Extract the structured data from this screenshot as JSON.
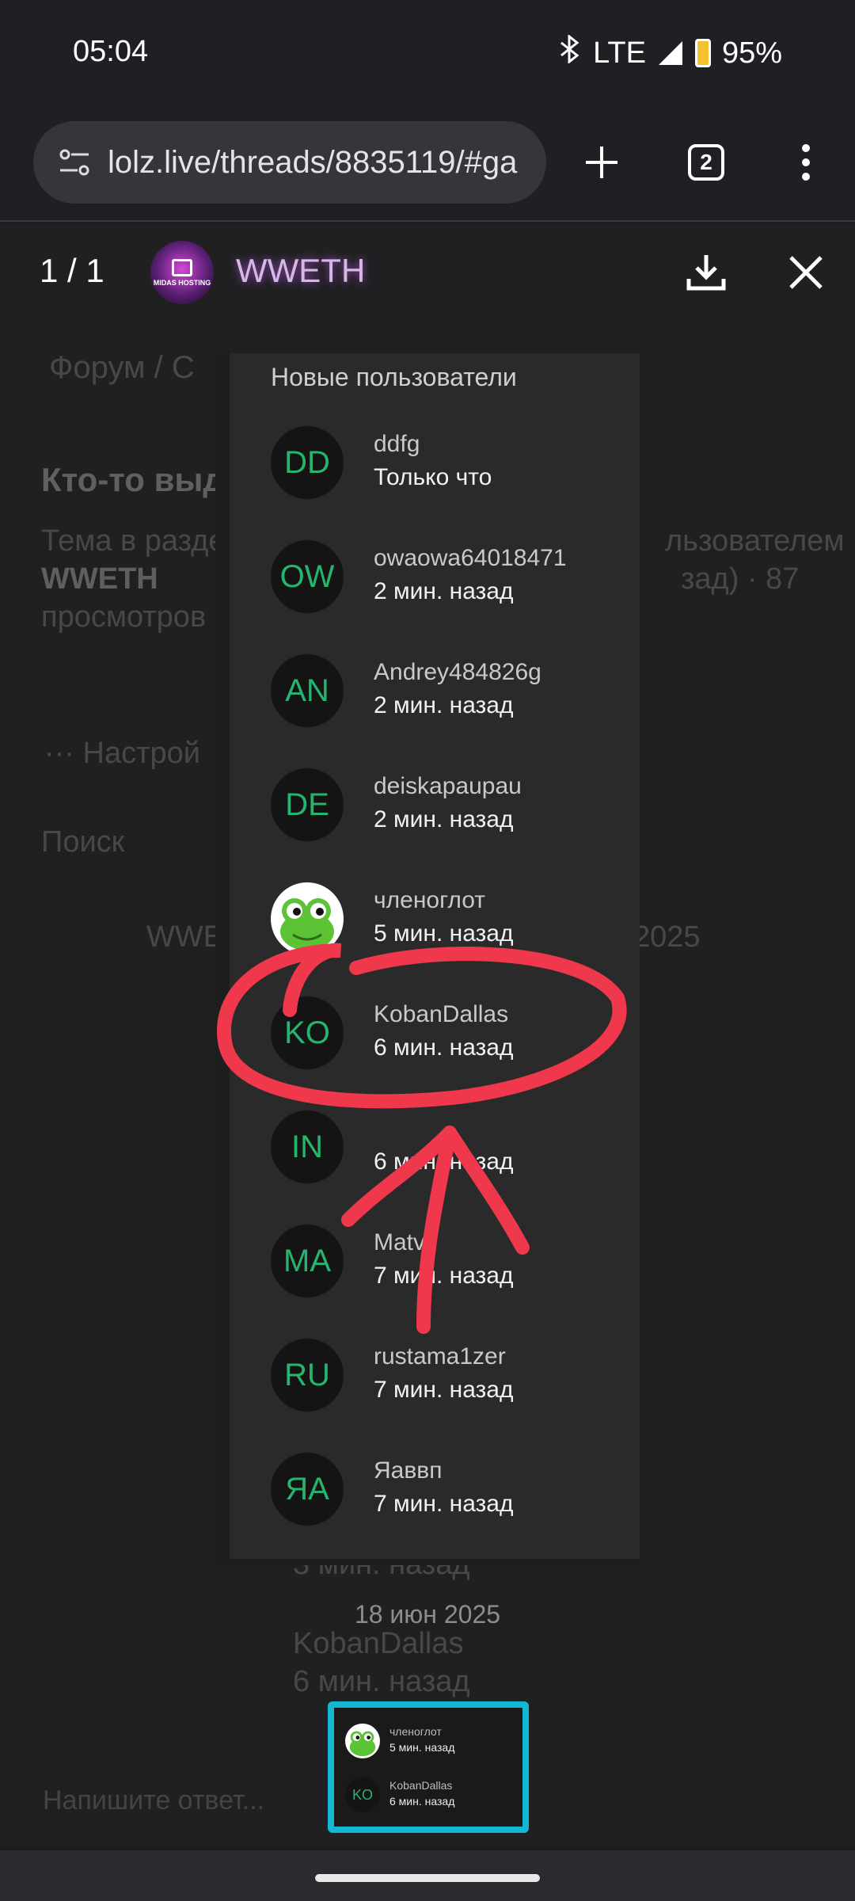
{
  "status": {
    "time": "05:04",
    "network": "LTE",
    "battery": "95%"
  },
  "browser": {
    "url": "lolz.live/threads/8835119/#ga",
    "tab_count": "2"
  },
  "viewer": {
    "counter": "1 / 1",
    "author": "WWETH",
    "avatar_text": "MIDAS HOSTING"
  },
  "background_page": {
    "breadcrumb": "Форум / С",
    "thread_title": "Кто-то выд",
    "meta_line1": "Тема в разде",
    "meta_line1b": "льзователем",
    "meta_line2": "WWETH",
    "meta_line2b": "зад) · 87",
    "meta_line3": "просмотров",
    "settings": "··· Настрой",
    "search": "Поиск",
    "post_author": "WWE",
    "post_date": "2025",
    "older_time": "3 мин. назад",
    "older_name": "KobanDallas",
    "older_time2": "6 мин. назад"
  },
  "panel": {
    "title": "Новые пользователи",
    "users": [
      {
        "initials": "DD",
        "name": "ddfg",
        "time": "Только что"
      },
      {
        "initials": "OW",
        "name": "owaowa64018471",
        "time": "2 мин. назад"
      },
      {
        "initials": "AN",
        "name": "Andrey484826g",
        "time": "2 мин. назад"
      },
      {
        "initials": "DE",
        "name": "deiskapaupau",
        "time": "2 мин. назад"
      },
      {
        "initials": "",
        "name": "членоглот",
        "time": "5 мин. назад",
        "avatar": "frog-icon"
      },
      {
        "initials": "KO",
        "name": "KobanDallas",
        "time": "6 мин. назад"
      },
      {
        "initials": "IN",
        "name": "",
        "time": "6 мин. назад"
      },
      {
        "initials": "MA",
        "name": "Matv",
        "time": "7 мин. назад"
      },
      {
        "initials": "RU",
        "name": "rustama1zer",
        "time": "7 мин. назад"
      },
      {
        "initials": "ЯА",
        "name": "Яаввп",
        "time": "7 мин. назад"
      }
    ]
  },
  "date_separator": "18 июн 2025",
  "thumbnail": {
    "rows": [
      {
        "initials": "",
        "name": "членоглот",
        "time": "5 мин. назад",
        "avatar": "frog-icon"
      },
      {
        "initials": "KO",
        "name": "KobanDallas",
        "time": "6 мин. назад"
      }
    ]
  },
  "reply": {
    "placeholder": "Напишите ответ..."
  },
  "colors": {
    "annotation": "#f0384c",
    "thumbnail_border": "#14b7d2",
    "initials": "#27b46e"
  }
}
